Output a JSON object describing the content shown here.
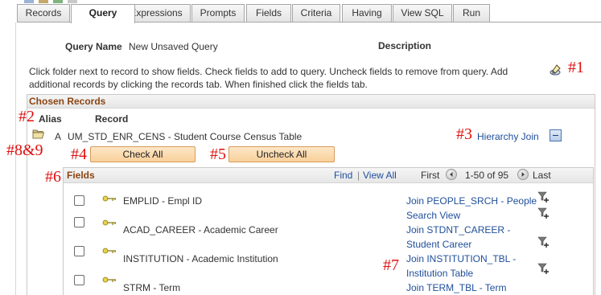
{
  "tabs": [
    "Records",
    "Query",
    "Expressions",
    "Prompts",
    "Fields",
    "Criteria",
    "Having",
    "View SQL",
    "Run"
  ],
  "active_tab": "Query",
  "query_name_label": "Query Name",
  "query_name_value": "New Unsaved Query",
  "description_label": "Description",
  "instructions": "Click folder next to record to show fields. Check fields to add to query. Uncheck fields to remove from query. Add additional records by clicking the records tab. When finished click the fields tab.",
  "chosen_records": {
    "title": "Chosen Records",
    "alias_header": "Alias",
    "record_header": "Record",
    "row": {
      "alias": "A",
      "record": "UM_STD_ENR_CENS - Student Course Census  Table",
      "hierarchy_join": "Hierarchy Join"
    },
    "check_all": "Check All",
    "uncheck_all": "Uncheck All"
  },
  "fields_grid": {
    "title": "Fields",
    "find": "Find",
    "separator": "|",
    "view_all": "View All",
    "first": "First",
    "range": "1-50 of 95",
    "last": "Last",
    "rows": [
      {
        "name": "EMPLID - Empl ID",
        "join_line1": "Join PEOPLE_SRCH - People",
        "join_line2": "Search View"
      },
      {
        "name": "ACAD_CAREER - Academic Career",
        "join_line1": "Join STDNT_CAREER -",
        "join_line2": "Student Career"
      },
      {
        "name": "INSTITUTION - Academic Institution",
        "join_line1": "Join INSTITUTION_TBL -",
        "join_line2": "Institution Table"
      },
      {
        "name": "STRM - Term",
        "join_line1": "Join TERM_TBL - Term",
        "join_line2": ""
      }
    ]
  },
  "annotations": {
    "a1": "#1",
    "a2": "#2",
    "a3": "#3",
    "a4": "#4",
    "a5": "#5",
    "a6": "#6",
    "a7": "#7",
    "a89": "#8&9"
  },
  "icons": {
    "edit": "pencil-icon",
    "folder": "folder-open-icon",
    "key": "key-icon",
    "join": "join-funnel-icon",
    "prev": "arrow-left-icon",
    "next": "arrow-right-icon",
    "collapse": "collapse-minus-icon"
  },
  "colors": {
    "section_title": "#8b4513",
    "link": "#1f4e9b",
    "annotation": "#e01010",
    "button_fill": "#f9d09a",
    "button_border": "#d69c5b"
  }
}
